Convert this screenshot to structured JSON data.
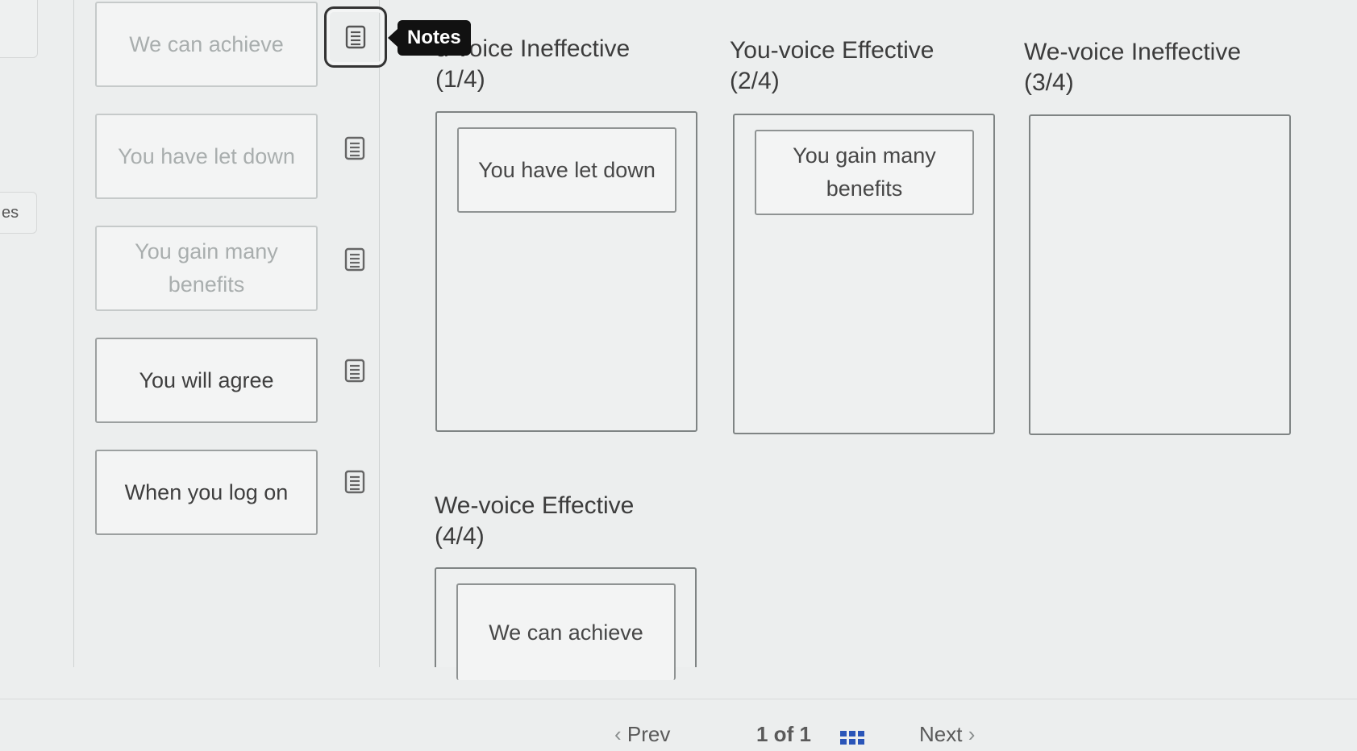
{
  "side": {
    "tab_label": "es"
  },
  "source_cards": [
    {
      "label": "We can achieve",
      "state": "used"
    },
    {
      "label": "You have let down",
      "state": "used"
    },
    {
      "label": "You gain many benefits",
      "state": "used"
    },
    {
      "label": "You will agree",
      "state": "free"
    },
    {
      "label": "When you log on",
      "state": "free"
    }
  ],
  "tooltip": {
    "label": "Notes"
  },
  "categories": [
    {
      "title": "You-voice Ineffective\n(1/4)",
      "visible_title": "u-voice Ineffective\n(1/4)",
      "items": [
        "You have let down"
      ]
    },
    {
      "title": "You-voice Effective\n(2/4)",
      "items": [
        "You gain many benefits"
      ]
    },
    {
      "title": "We-voice Ineffective\n(3/4)",
      "items": []
    },
    {
      "title": "We-voice Effective\n(4/4)",
      "items": [
        "We can achieve"
      ]
    }
  ],
  "pager": {
    "prev": "Prev",
    "page_info": "1 of 1",
    "next": "Next"
  },
  "icons": {
    "notes": "notes-icon",
    "grid": "grid-icon",
    "prev": "chevron-left-icon",
    "next": "chevron-right-icon"
  }
}
